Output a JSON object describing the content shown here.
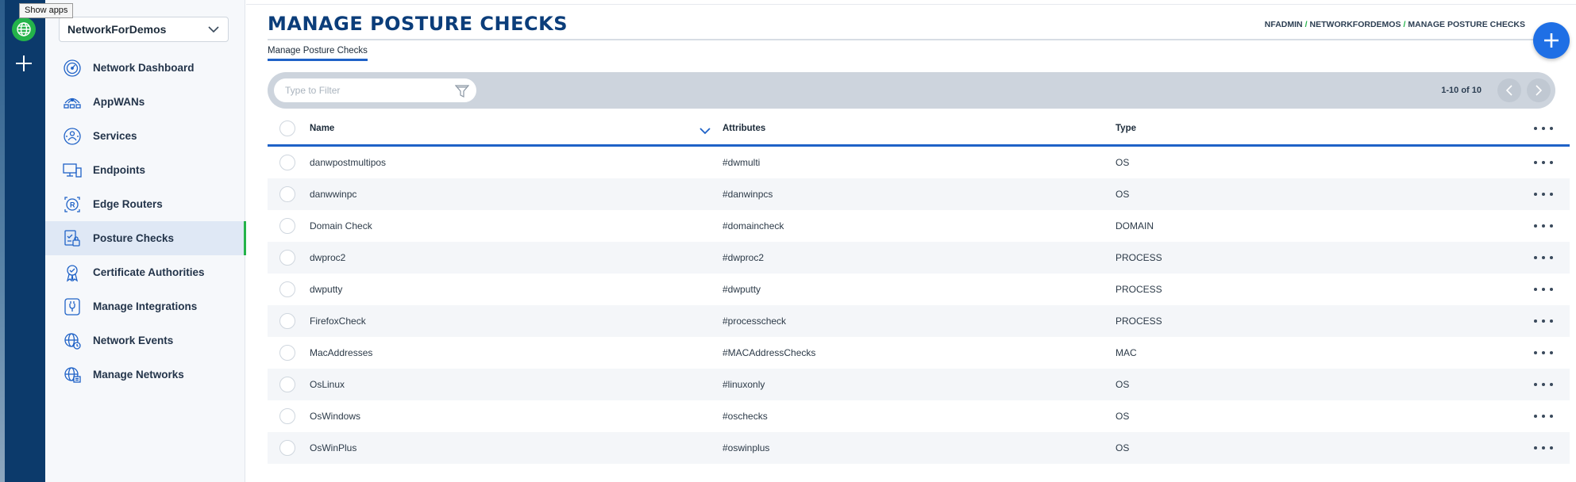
{
  "tooltip": "Show apps",
  "network_selector": {
    "value": "NetworkForDemos"
  },
  "sidebar": {
    "items": [
      {
        "label": "Network Dashboard",
        "icon": "dashboard-gauge-icon",
        "active": false
      },
      {
        "label": "AppWANs",
        "icon": "appwan-icon",
        "active": false
      },
      {
        "label": "Services",
        "icon": "services-icon",
        "active": false
      },
      {
        "label": "Endpoints",
        "icon": "endpoints-icon",
        "active": false
      },
      {
        "label": "Edge Routers",
        "icon": "edge-router-icon",
        "active": false
      },
      {
        "label": "Posture Checks",
        "icon": "posture-check-icon",
        "active": true
      },
      {
        "label": "Certificate Authorities",
        "icon": "certificate-icon",
        "active": false
      },
      {
        "label": "Manage Integrations",
        "icon": "integrations-icon",
        "active": false
      },
      {
        "label": "Network Events",
        "icon": "network-events-icon",
        "active": false
      },
      {
        "label": "Manage Networks",
        "icon": "manage-networks-icon",
        "active": false
      }
    ]
  },
  "header": {
    "title": "MANAGE POSTURE CHECKS",
    "breadcrumb": [
      "NFADMIN",
      "NETWORKFORDEMOS",
      "MANAGE POSTURE CHECKS"
    ],
    "tab": "Manage Posture Checks"
  },
  "filter": {
    "placeholder": "Type to Filter"
  },
  "paging": {
    "label": "1-10 of 10"
  },
  "table": {
    "columns": {
      "name": "Name",
      "attributes": "Attributes",
      "type": "Type"
    },
    "rows": [
      {
        "name": "danwpostmultipos",
        "attributes": "#dwmulti",
        "type": "OS"
      },
      {
        "name": "danwwinpc",
        "attributes": "#danwinpcs",
        "type": "OS"
      },
      {
        "name": "Domain Check",
        "attributes": "#domaincheck",
        "type": "DOMAIN"
      },
      {
        "name": "dwproc2",
        "attributes": "#dwproc2",
        "type": "PROCESS"
      },
      {
        "name": "dwputty",
        "attributes": "#dwputty",
        "type": "PROCESS"
      },
      {
        "name": "FirefoxCheck",
        "attributes": "#processcheck",
        "type": "PROCESS"
      },
      {
        "name": "MacAddresses",
        "attributes": "#MACAddressChecks",
        "type": "MAC"
      },
      {
        "name": "OsLinux",
        "attributes": "#linuxonly",
        "type": "OS"
      },
      {
        "name": "OsWindows",
        "attributes": "#oschecks",
        "type": "OS"
      },
      {
        "name": "OsWinPlus",
        "attributes": "#oswinplus",
        "type": "OS"
      }
    ]
  },
  "colors": {
    "brand": "#0b3d7a",
    "accent": "#1f62c7",
    "active_indicator": "#24b34a",
    "fab": "#1f6fe5"
  }
}
